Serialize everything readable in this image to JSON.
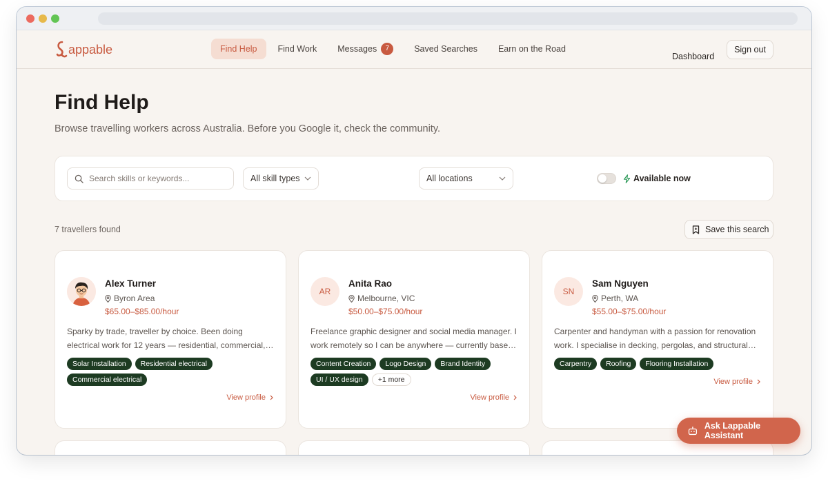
{
  "brand": {
    "logo_text": "appable",
    "accent": "#c85a40",
    "tag_color": "#1d3b22"
  },
  "nav": {
    "links": [
      {
        "label": "Find Help",
        "active": true
      },
      {
        "label": "Find Work"
      },
      {
        "label": "Messages",
        "badge": "7"
      },
      {
        "label": "Saved Searches"
      },
      {
        "label": "Earn on the Road"
      }
    ],
    "dashboard": "Dashboard",
    "signout": "Sign out"
  },
  "page": {
    "title": "Find Help",
    "subtitle": "Browse travelling workers across Australia. Before you Google it, check the community."
  },
  "filters": {
    "search_placeholder": "Search skills or keywords...",
    "skill_select": "All skill types",
    "location_select": "All locations",
    "available_label": "Available now",
    "available_on": false
  },
  "results": {
    "count_label": "7 travellers found",
    "save_label": "Save this search"
  },
  "cards": [
    {
      "initials": "",
      "avatar": "cartoon-man-avatar",
      "name": "Alex Turner",
      "location": "Byron Area",
      "rate": "$65.00–$85.00/hour",
      "bio": "Sparky by trade, traveller by choice. Been doing electrical work for 12 years — residential, commercial, solar installation and more.",
      "tags": [
        "Solar Installation",
        "Residential electrical",
        "Commercial electrical"
      ],
      "view": "View profile"
    },
    {
      "initials": "AR",
      "name": "Anita Rao",
      "location": "Melbourne, VIC",
      "rate": "$50.00–$75.00/hour",
      "bio": "Freelance graphic designer and social media manager. I work remotely so I can be anywhere — currently based in Melbourne.",
      "tags": [
        "Content Creation",
        "Logo Design",
        "Brand Identity",
        "UI / UX design"
      ],
      "more": "+1 more",
      "view": "View profile"
    },
    {
      "initials": "SN",
      "name": "Sam Nguyen",
      "location": "Perth, WA",
      "rate": "$55.00–$75.00/hour",
      "bio": "Carpenter and handyman with a passion for renovation work. I specialise in decking, pergolas, and structural repairs.",
      "tags": [
        "Carpentry",
        "Roofing",
        "Flooring Installation"
      ],
      "view": "View profile"
    }
  ],
  "assistant": {
    "label": "Ask Lappable Assistant"
  }
}
